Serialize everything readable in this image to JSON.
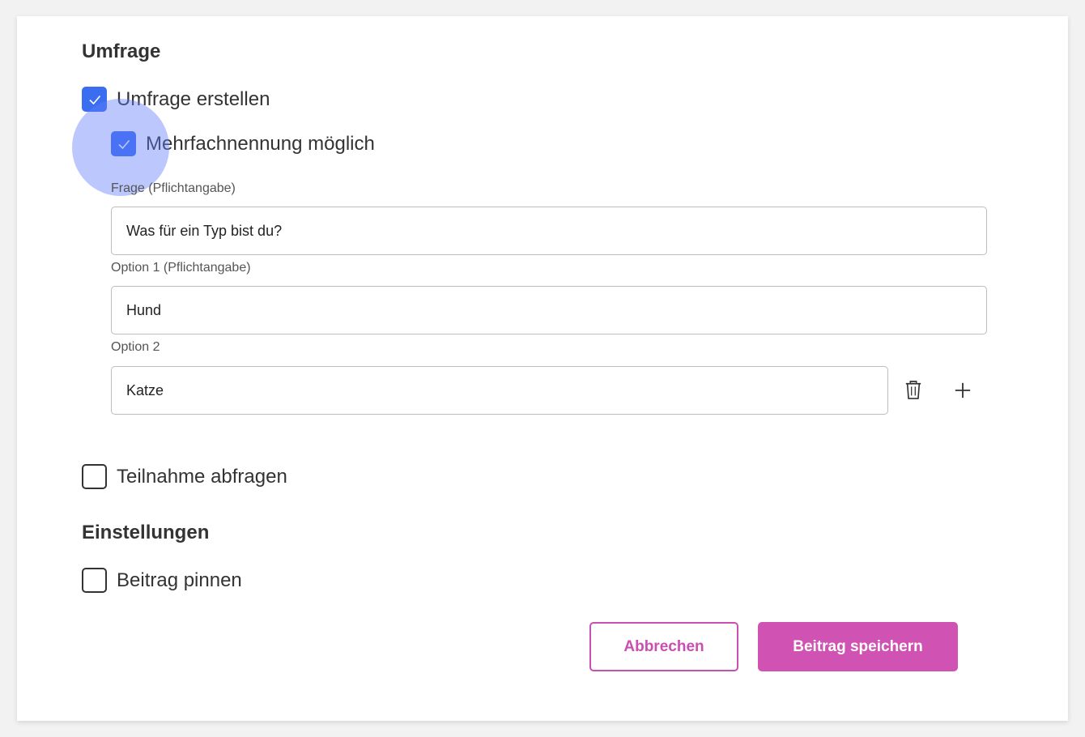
{
  "poll": {
    "heading": "Umfrage",
    "create_poll": {
      "label": "Umfrage erstellen",
      "checked": true
    },
    "multiple_choice": {
      "label": "Mehrfachnennung möglich",
      "checked": true
    },
    "question": {
      "label": "Frage (Pflichtangabe)",
      "value": "Was für ein Typ bist du?"
    },
    "options": [
      {
        "label": "Option 1 (Pflichtangabe)",
        "value": "Hund"
      },
      {
        "label": "Option 2",
        "value": "Katze"
      }
    ]
  },
  "attendance": {
    "label": "Teilnahme abfragen",
    "checked": false
  },
  "settings": {
    "heading": "Einstellungen",
    "pin_post": {
      "label": "Beitrag pinnen",
      "checked": false
    }
  },
  "actions": {
    "cancel_label": "Abbrechen",
    "save_label": "Beitrag speichern"
  },
  "colors": {
    "checkbox_accent": "#3b6df0",
    "button_accent": "#d052b3"
  },
  "icons": {
    "check": "check-icon",
    "delete": "trash-icon",
    "add": "plus-icon"
  }
}
